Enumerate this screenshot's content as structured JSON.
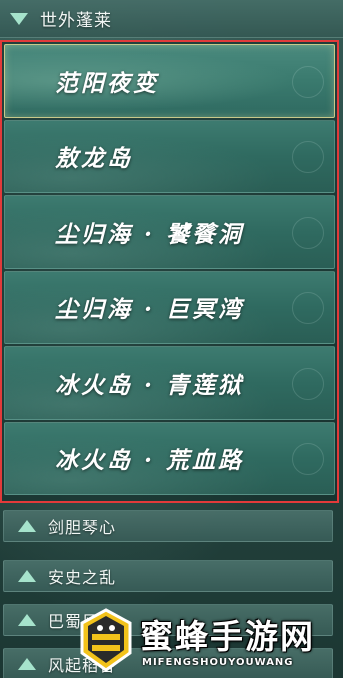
{
  "expanded_section": {
    "label": "世外蓬莱"
  },
  "list_items": [
    {
      "label": "范阳夜变",
      "active": true
    },
    {
      "label": "敖龙岛",
      "active": false
    },
    {
      "label": "尘归海 · 饕餮洞",
      "active": false
    },
    {
      "label": "尘归海 · 巨冥湾",
      "active": false
    },
    {
      "label": "冰火岛 · 青莲狱",
      "active": false
    },
    {
      "label": "冰火岛 · 荒血路",
      "active": false
    }
  ],
  "collapsed_sections": [
    {
      "label": "剑胆琴心"
    },
    {
      "label": "安史之乱"
    },
    {
      "label": "巴蜀风云"
    },
    {
      "label": "风起稻香"
    }
  ],
  "watermark": {
    "title": "蜜蜂手游网",
    "subtitle": "MIFENGSHOUYOUWANG"
  },
  "colors": {
    "highlight_border": "#e23a3a",
    "triangle": "#a6e3cc",
    "active_item_border": "#c9c98a"
  }
}
